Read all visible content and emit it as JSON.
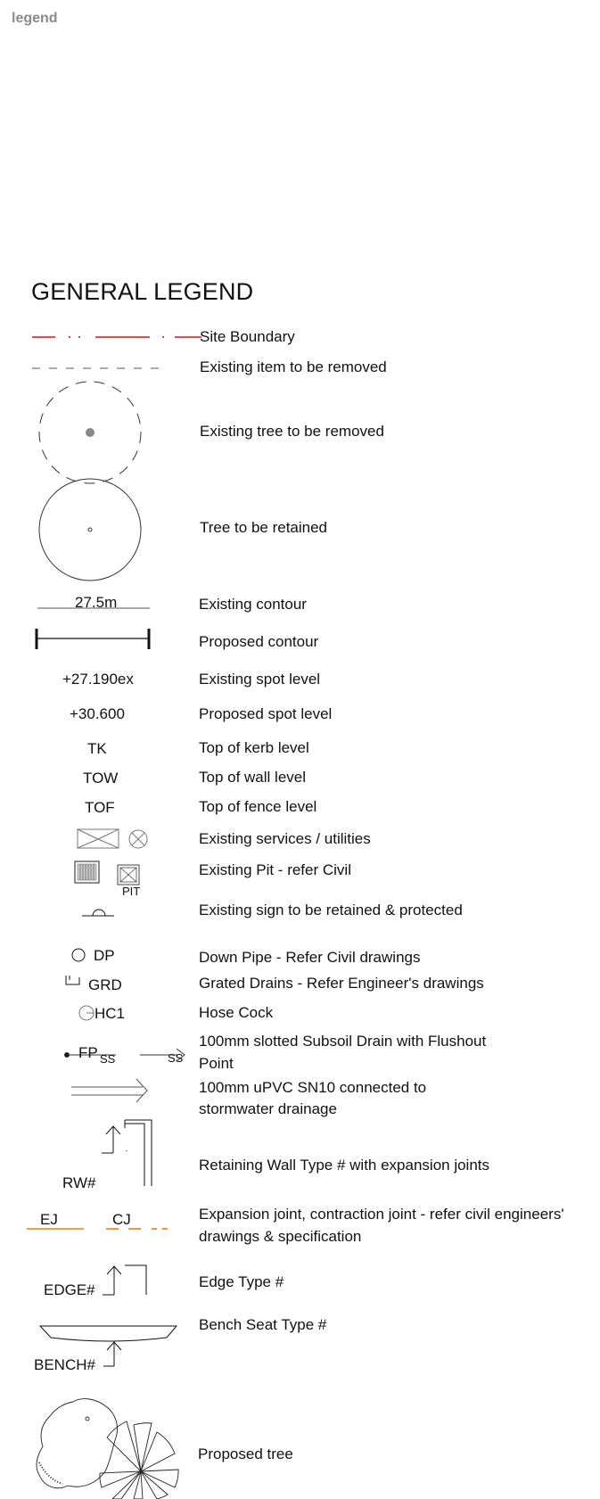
{
  "page_label": "legend",
  "title": "GENERAL LEGEND",
  "items": [
    {
      "label": "Site Boundary"
    },
    {
      "label": "Existing item to be removed"
    },
    {
      "label": "Existing tree to be removed"
    },
    {
      "label": "Tree to be retained"
    },
    {
      "label": "Existing contour",
      "symbol_text": "27.5m"
    },
    {
      "label": "Proposed contour"
    },
    {
      "label": "Existing spot level",
      "symbol_text": "+27.190ex"
    },
    {
      "label": "Proposed spot level",
      "symbol_text": "+30.600"
    },
    {
      "label": "Top of kerb level",
      "symbol_text": "TK"
    },
    {
      "label": "Top of wall level",
      "symbol_text": "TOW"
    },
    {
      "label": "Top of fence level",
      "symbol_text": "TOF"
    },
    {
      "label": "Existing services / utilities"
    },
    {
      "label": "Existing Pit - refer Civil",
      "symbol_text": "PIT"
    },
    {
      "label": "Existing sign to be retained & protected"
    },
    {
      "label": "Down Pipe -  Refer Civil drawings",
      "symbol_text": "DP"
    },
    {
      "label": "Grated Drains - Refer Engineer's drawings",
      "symbol_text": "GRD"
    },
    {
      "label": "Hose Cock",
      "symbol_text": "HC1"
    },
    {
      "label_lines": [
        "100mm slotted Subsoil Drain with Flushout",
        "Point"
      ],
      "symbol_text": "FP",
      "symbol_sub": "SS"
    },
    {
      "label_lines": [
        "100mm uPVC SN10 connected to",
        "stormwater drainage"
      ]
    },
    {
      "label": "Retaining Wall Type # with expansion joints",
      "symbol_text": "RW#"
    },
    {
      "label_lines": [
        "Expansion joint, contraction joint - refer civil engineers'",
        "drawings & specification"
      ],
      "symbol_text_a": "EJ",
      "symbol_text_b": "CJ"
    },
    {
      "label": "Edge Type #",
      "symbol_text": "EDGE#"
    },
    {
      "label": "Bench Seat Type #",
      "symbol_text": "BENCH#"
    },
    {
      "label": "Proposed tree"
    }
  ],
  "colors": {
    "boundary": "#e01010",
    "joint": "#f07a10",
    "line": "#333333"
  }
}
